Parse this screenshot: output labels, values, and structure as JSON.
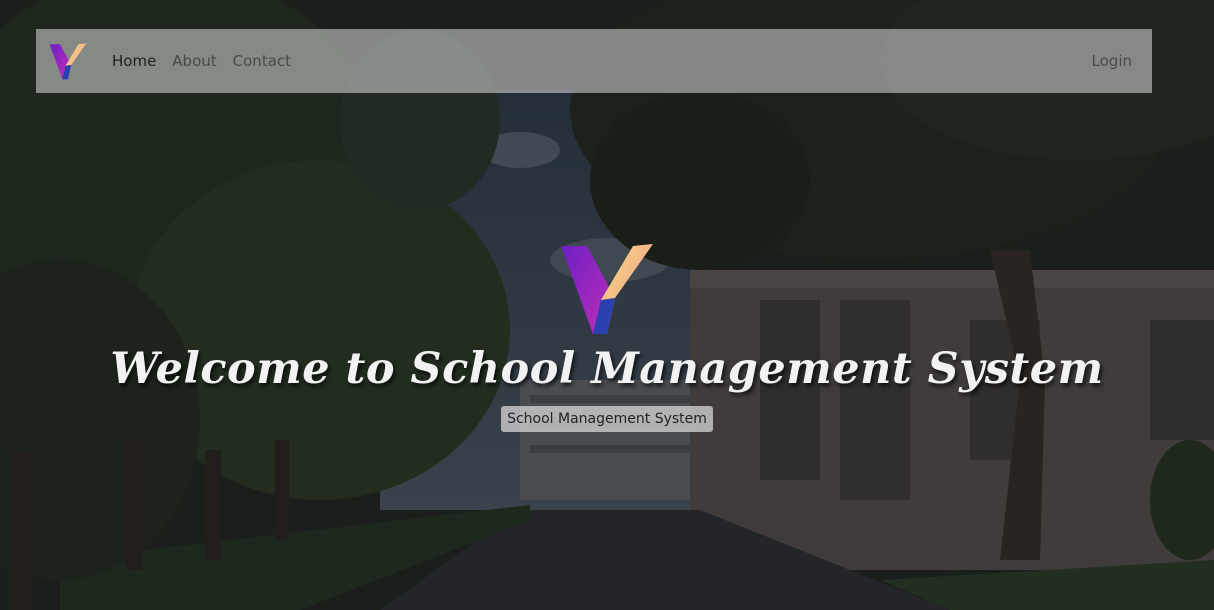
{
  "nav": {
    "logo_icon": "y-logo-icon",
    "links": [
      {
        "label": "Home",
        "active": true
      },
      {
        "label": "About",
        "active": false
      },
      {
        "label": "Contact",
        "active": false
      }
    ],
    "login_label": "Login"
  },
  "hero": {
    "logo_icon": "y-logo-icon",
    "title": "Welcome to School Management System",
    "badge": "School Management System"
  },
  "colors": {
    "logo_purple": "#8e2bd0",
    "logo_yellow": "#f5c65a",
    "logo_blue": "#2a3fb0",
    "navbar_bg": "rgba(220,220,220,0.55)"
  }
}
